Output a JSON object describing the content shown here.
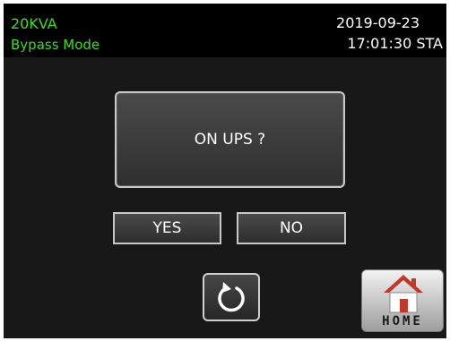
{
  "header": {
    "model": "20KVA",
    "mode": "Bypass Mode",
    "date": "2019-09-23",
    "time": "17:01:30 STA"
  },
  "dialog": {
    "message": "ON UPS ?",
    "yes_label": "YES",
    "no_label": "NO"
  },
  "footer": {
    "refresh_icon": "refresh-icon",
    "home_icon": "home-icon",
    "home_label": "HOME"
  },
  "colors": {
    "status_text": "#3ddc1f",
    "background": "#181818",
    "header_background": "#000000",
    "home_roof": "#c0392b"
  }
}
